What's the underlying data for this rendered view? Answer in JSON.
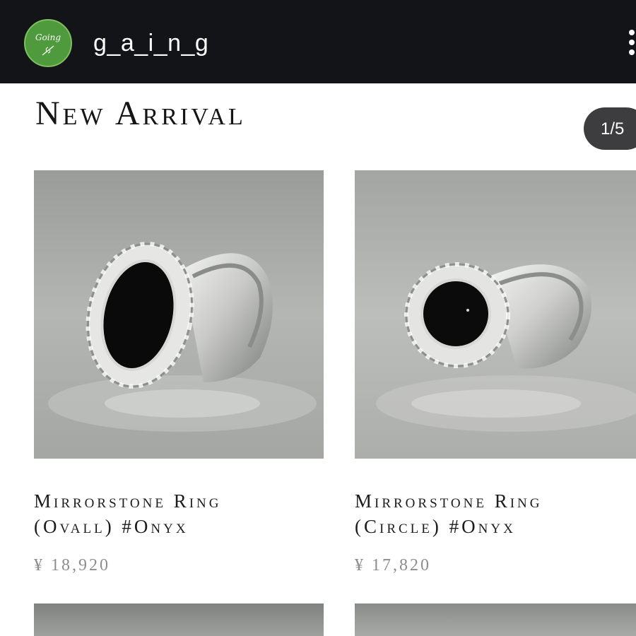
{
  "header": {
    "avatar_text": "Going",
    "username": "g_a_i_n_g"
  },
  "section": {
    "title": "New Arrival",
    "counter": "1/5"
  },
  "products": [
    {
      "name_line1": "Mirrorstone Ring",
      "name_line2": "(Ovall) #Onyx",
      "price": "¥ 18,920"
    },
    {
      "name_line1": "Mirrorstone Ring",
      "name_line2": "(Circle) #Onyx",
      "price": "¥ 17,820"
    }
  ],
  "colors": {
    "topbar": "#121418",
    "avatar": "#4e9a3c",
    "counter_pill": "#3d3d3f",
    "price_text": "#8d8d8d",
    "title_text": "#1c1c1c"
  },
  "icons": {
    "more": "more-vertical-icon",
    "avatar_leaf": "leaf-icon"
  }
}
